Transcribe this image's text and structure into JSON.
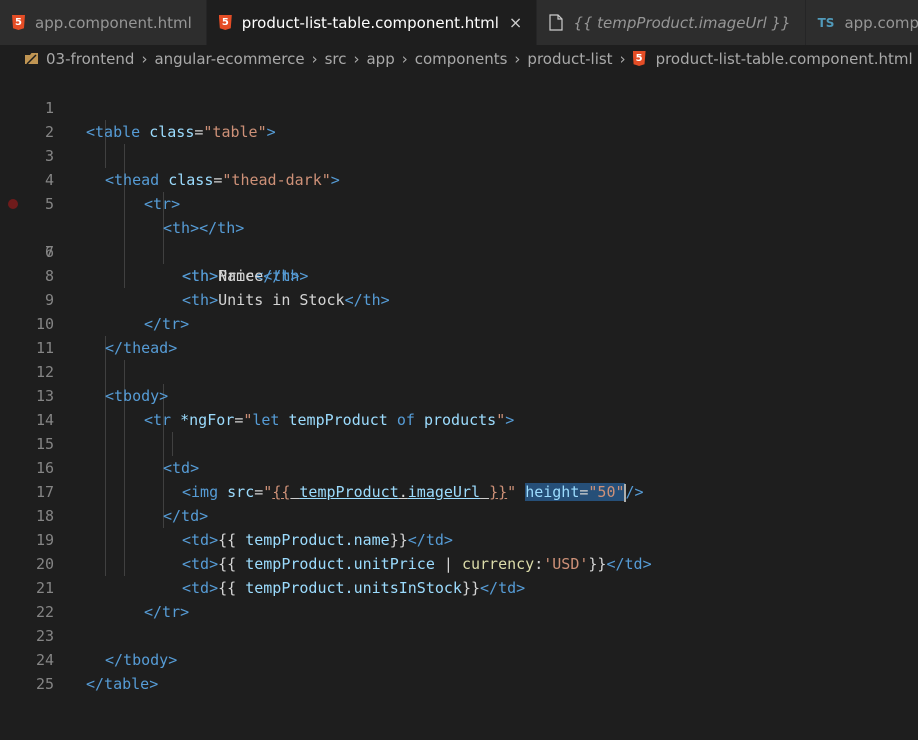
{
  "tabs": [
    {
      "label": "app.component.html",
      "icon": "html5-icon",
      "active": false
    },
    {
      "label": "product-list-table.component.html",
      "icon": "html5-icon",
      "active": true
    },
    {
      "label": "{{ tempProduct.imageUrl }}",
      "icon": "file-icon",
      "active": false
    },
    {
      "label": "app.comp",
      "icon": "typescript-icon",
      "active": false
    }
  ],
  "tab_close_glyph": "×",
  "html_icon_glyph": "5",
  "ts_icon_glyph": "TS",
  "breadcrumbs": [
    "03-frontend",
    "angular-ecommerce",
    "src",
    "app",
    "components",
    "product-list",
    "product-list-table.component.html"
  ],
  "breadcrumb_separator": "›",
  "editor": {
    "line_numbers": [
      "1",
      "2",
      "3",
      "4",
      "5",
      "6",
      "7",
      "8",
      "9",
      "10",
      "11",
      "12",
      "13",
      "14",
      "15",
      "16",
      "17",
      "18",
      "19",
      "20",
      "21",
      "22",
      "23",
      "24",
      "25"
    ],
    "breakpoint_line": "6",
    "tokens": {
      "l1_open": "<table",
      "l1_attr": "class",
      "l1_eq": "=",
      "l1_val": "\"table\"",
      "l1_close": ">",
      "l3_open": "<thead",
      "l3_attr": "class",
      "l3_eq": "=",
      "l3_val": "\"thead-dark\"",
      "l3_close": ">",
      "l4": "<tr>",
      "l5_open": "<th>",
      "l5_close": "</th>",
      "l6_open": "<th>",
      "l6_text": "Name",
      "l6_close": "</th>",
      "l7_open": "<th>",
      "l7_text": "Price",
      "l7_close": "</th>",
      "l8_open": "<th>",
      "l8_text": "Units in Stock",
      "l8_close": "</th>",
      "l9": "</tr>",
      "l10": "</thead>",
      "l12": "<tbody>",
      "l13_open": "<tr",
      "l13_attr": "*ngFor",
      "l13_eq": "=",
      "l13_q1": "\"",
      "l13_let": "let",
      "l13_var": "tempProduct",
      "l13_of": "of",
      "l13_prods": "products",
      "l13_q2": "\"",
      "l13_close": ">",
      "l15": "<td>",
      "l16_open": "<img",
      "l16_attr": "src",
      "l16_eq": "=",
      "l16_q1": "\"",
      "l16_b1": "{{",
      "l16_obj": "tempProduct",
      "l16_dot": ".",
      "l16_prop": "imageUrl",
      "l16_b2": "}}",
      "l16_q2": "\"",
      "l16_attr2": "height",
      "l16_eq2": "=",
      "l16_val2": "\"50\"",
      "l16_close": "/>",
      "l17": "</td>",
      "l18_open": "<td>",
      "l18_b1": "{{",
      "l18_expr": "tempProduct.name",
      "l18_b2": "}}",
      "l18_close": "</td>",
      "l19_open": "<td>",
      "l19_b1": "{{",
      "l19_expr": "tempProduct.unitPrice",
      "l19_pipe": "|",
      "l19_fn": "currency",
      "l19_colon": ":",
      "l19_str": "'USD'",
      "l19_b2": "}}",
      "l19_close": "</td>",
      "l20_open": "<td>",
      "l20_b1": "{{",
      "l20_expr": "tempProduct.unitsInStock",
      "l20_b2": "}}",
      "l20_close": "</td>",
      "l21": "</tr>",
      "l23": "</tbody>",
      "l24": "</table>"
    }
  },
  "colors": {
    "tag": "#569cd6",
    "attribute": "#9cdcfe",
    "string": "#ce9178",
    "text": "#d4d4d4",
    "function": "#dcdcaa",
    "selection": "#264f78"
  }
}
